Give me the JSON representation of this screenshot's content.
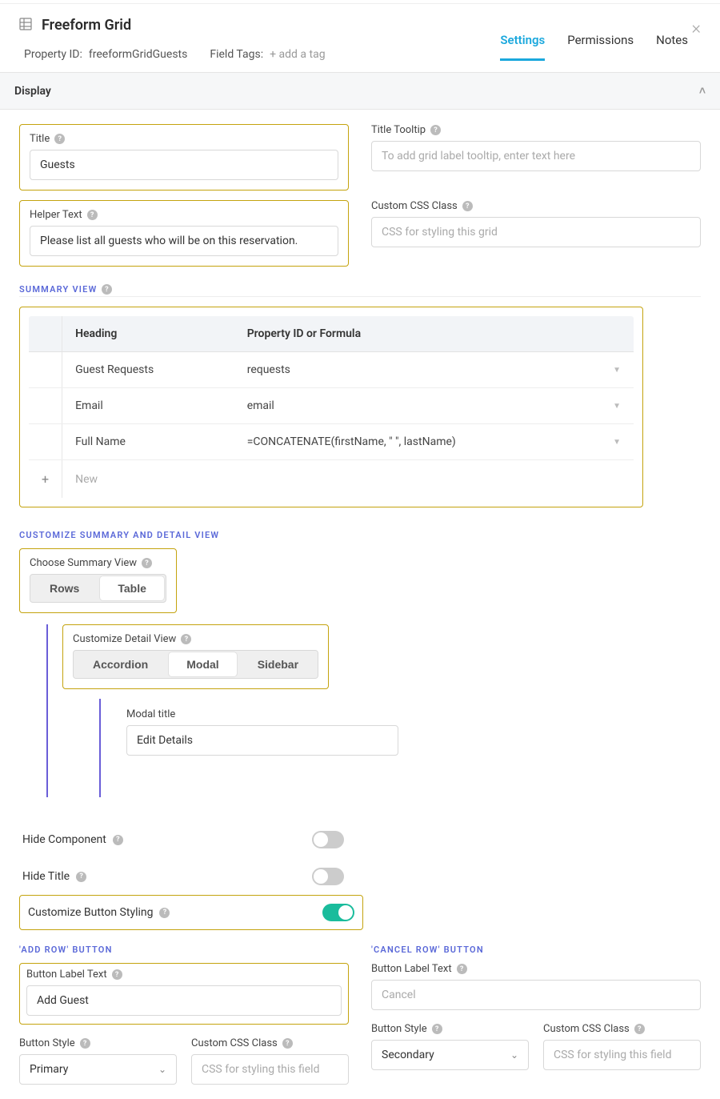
{
  "header": {
    "main_title": "Freeform Grid",
    "property_id_label": "Property ID:",
    "property_id_value": "freeformGridGuests",
    "field_tags_label": "Field Tags:",
    "add_tag": "+ add a tag"
  },
  "tabs": {
    "settings": "Settings",
    "permissions": "Permissions",
    "notes": "Notes"
  },
  "section_display": "Display",
  "display": {
    "title_label": "Title",
    "title_value": "Guests",
    "title_tooltip_label": "Title Tooltip",
    "title_tooltip_placeholder": "To add grid label tooltip, enter text here",
    "helper_text_label": "Helper Text",
    "helper_text_value": "Please list all guests who will be on this reservation.",
    "css_class_label": "Custom CSS Class",
    "css_class_placeholder": "CSS for styling this grid"
  },
  "summary_view_label": "SUMMARY VIEW",
  "summary_table": {
    "col_heading": "Heading",
    "col_prop": "Property ID or Formula",
    "rows": [
      {
        "heading": "Guest Requests",
        "prop": "requests"
      },
      {
        "heading": "Email",
        "prop": "email"
      },
      {
        "heading": "Full Name",
        "prop": "=CONCATENATE(firstName, \" \", lastName)"
      }
    ],
    "new_label": "New"
  },
  "customize_view_label": "CUSTOMIZE SUMMARY AND DETAIL VIEW",
  "choose_summary": {
    "label": "Choose Summary View",
    "rows": "Rows",
    "table": "Table"
  },
  "customize_detail": {
    "label": "Customize Detail View",
    "accordion": "Accordion",
    "modal": "Modal",
    "sidebar": "Sidebar"
  },
  "modal_title": {
    "label": "Modal title",
    "value": "Edit Details"
  },
  "toggles": {
    "hide_component": "Hide Component",
    "hide_title": "Hide Title",
    "customize_button_styling": "Customize Button Styling"
  },
  "add_row": {
    "section_title": "'ADD ROW' BUTTON",
    "label_text": "Button Label Text",
    "label_value": "Add Guest",
    "style_label": "Button Style",
    "style_value": "Primary",
    "css_label": "Custom CSS Class",
    "css_placeholder": "CSS for styling this field"
  },
  "cancel_row": {
    "section_title": "'CANCEL ROW' BUTTON",
    "label_text": "Button Label Text",
    "label_placeholder": "Cancel",
    "style_label": "Button Style",
    "style_value": "Secondary",
    "css_label": "Custom CSS Class",
    "css_placeholder": "CSS for styling this field"
  }
}
